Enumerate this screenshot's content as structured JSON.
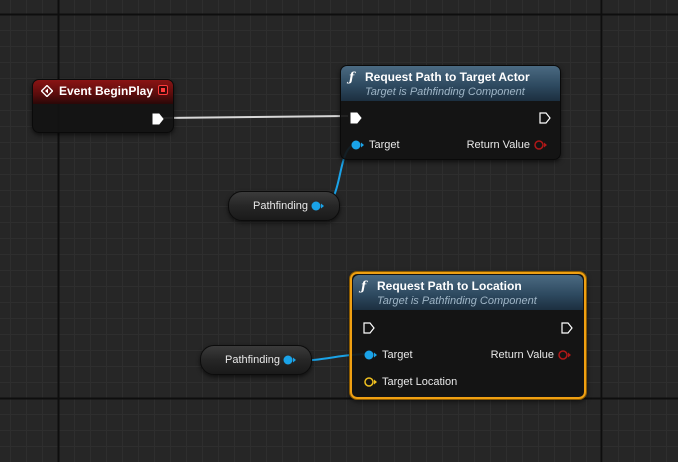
{
  "colors": {
    "background": "#262626",
    "grid_minor": "#2e2e2e",
    "grid_major": "#0e0e0e",
    "exec_wire": "#d8d8d8",
    "object_pin": "#1aa3e8",
    "return_pin": "#b01818",
    "vector_pin": "#f0c020",
    "selection": "#f0a012"
  },
  "nodes": {
    "begin_play": {
      "title": "Event BeginPlay",
      "icon": "event-diamond-icon",
      "delegate_icon": "delegate-square-icon"
    },
    "request_actor": {
      "title": "Request Path to Target Actor",
      "subtitle": "Target is Pathfinding Component",
      "icon": "function-icon",
      "target_label": "Target",
      "return_label": "Return Value"
    },
    "request_location": {
      "title": "Request Path to Location",
      "subtitle": "Target is Pathfinding Component",
      "icon": "function-icon",
      "target_label": "Target",
      "return_label": "Return Value",
      "location_label": "Target Location",
      "selected": true
    },
    "var_pathfinding_1": {
      "label": "Pathfinding"
    },
    "var_pathfinding_2": {
      "label": "Pathfinding"
    }
  }
}
